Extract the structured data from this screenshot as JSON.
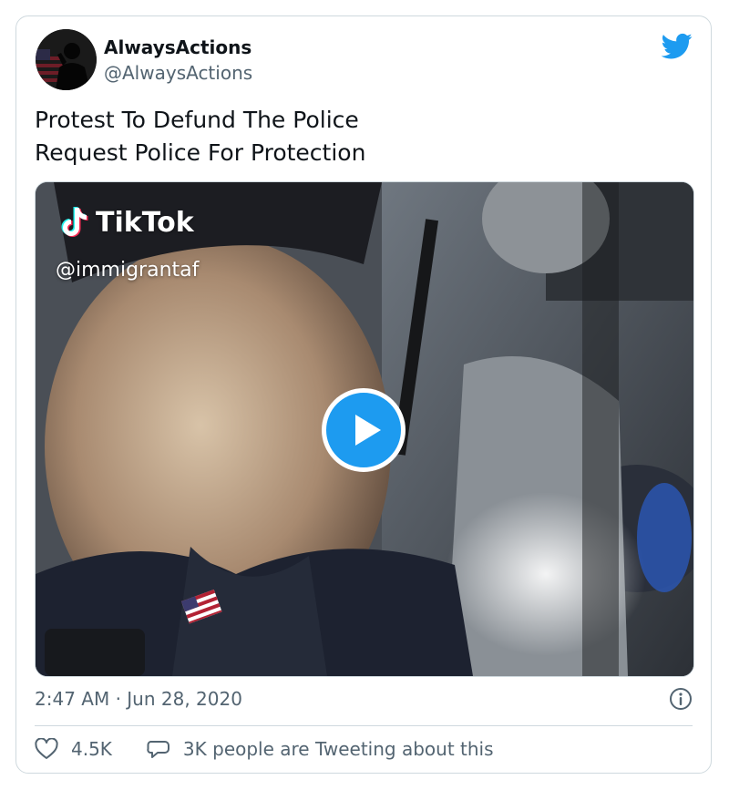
{
  "tweet": {
    "author_name": "AlwaysActions",
    "author_handle": "@AlwaysActions",
    "text_lines": [
      "Protest To Defund The Police",
      "Request Police For Protection"
    ],
    "timestamp": "2:47 AM · Jun 28, 2020",
    "likes": "4.5K",
    "conversation_label": "3K people are Tweeting about this"
  },
  "media": {
    "type": "video",
    "watermark_brand": "TikTok",
    "watermark_handle": "@immigrantaf"
  },
  "icons": {
    "brand": "twitter-bird-icon",
    "play": "play-icon",
    "info": "info-icon",
    "like": "heart-icon",
    "reply": "speech-bubble-icon"
  },
  "colors": {
    "accent": "#1d9bf0",
    "text_primary": "#0f1419",
    "text_secondary": "#536471",
    "border": "#cfd9de"
  }
}
